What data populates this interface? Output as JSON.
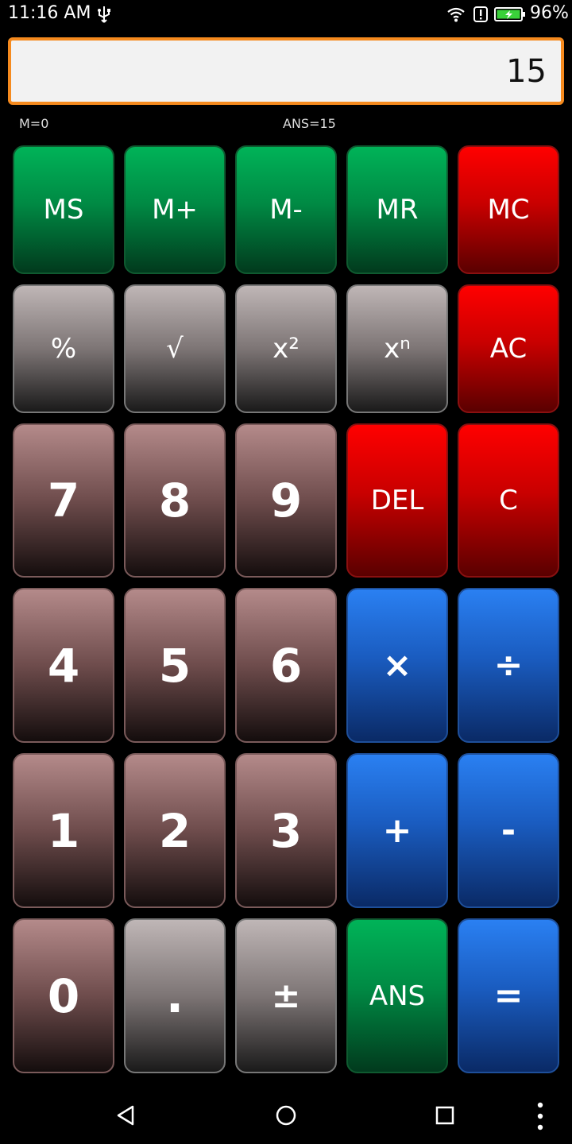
{
  "status": {
    "time": "11:16 AM",
    "battery": "96%"
  },
  "display": {
    "value": "15",
    "memory": "M=0",
    "ans": "ANS=15"
  },
  "keys": {
    "ms": "MS",
    "mplus": "M+",
    "mminus": "M-",
    "mr": "MR",
    "mc": "MC",
    "percent": "%",
    "sqrt": "√",
    "square": "x²",
    "power": "xⁿ",
    "ac": "AC",
    "seven": "7",
    "eight": "8",
    "nine": "9",
    "del": "DEL",
    "c": "C",
    "four": "4",
    "five": "5",
    "six": "6",
    "multiply": "×",
    "divide": "÷",
    "one": "1",
    "two": "2",
    "three": "3",
    "plus": "+",
    "minus": "-",
    "zero": "0",
    "dot": ".",
    "plusminus": "±",
    "ans": "ANS",
    "equals": "="
  },
  "colors": {
    "display_border": "#f58a1e",
    "memory_keys": "#008a44",
    "clear_keys": "#c90000",
    "operator_keys": "#1a5cc0"
  },
  "icons": [
    "usb-icon",
    "wifi-icon",
    "alert-icon",
    "battery-icon",
    "back-icon",
    "home-icon",
    "recent-apps-icon",
    "more-options-icon"
  ]
}
